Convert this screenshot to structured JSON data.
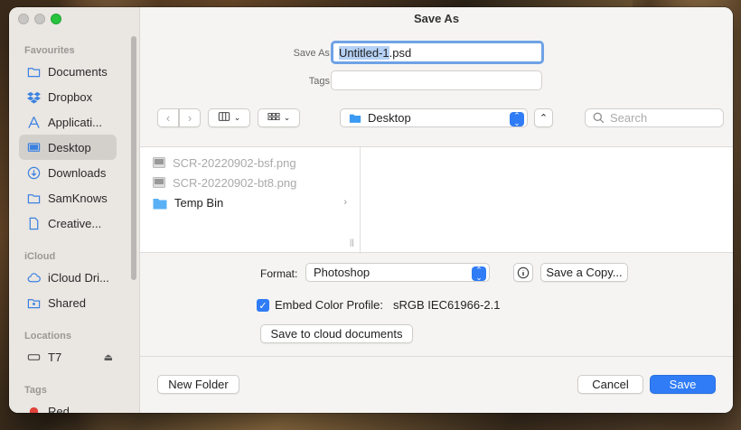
{
  "window": {
    "title": "Save As"
  },
  "sidebar": {
    "sections": [
      {
        "label": "Favourites"
      },
      {
        "label": "iCloud"
      },
      {
        "label": "Locations"
      },
      {
        "label": "Tags"
      }
    ],
    "favourites": [
      {
        "label": "Documents",
        "icon": "folder-icon"
      },
      {
        "label": "Dropbox",
        "icon": "dropbox-icon"
      },
      {
        "label": "Applicati...",
        "icon": "applications-icon"
      },
      {
        "label": "Desktop",
        "icon": "desktop-icon",
        "active": true
      },
      {
        "label": "Downloads",
        "icon": "downloads-icon"
      },
      {
        "label": "SamKnows",
        "icon": "folder-icon"
      },
      {
        "label": "Creative...",
        "icon": "document-icon"
      }
    ],
    "icloud": [
      {
        "label": "iCloud Dri...",
        "icon": "cloud-icon"
      },
      {
        "label": "Shared",
        "icon": "shared-folder-icon"
      }
    ],
    "locations": [
      {
        "label": "T7",
        "icon": "drive-icon"
      }
    ],
    "tags": [
      {
        "label": "Red",
        "color": "#e0433b"
      }
    ]
  },
  "form": {
    "save_as_label": "Save As:",
    "filename_selected": "Untitled-1",
    "filename_rest": ".psd",
    "tags_label": "Tags:",
    "tags_value": ""
  },
  "toolbar": {
    "location": "Desktop",
    "search_placeholder": "Search"
  },
  "files": [
    {
      "name": "SCR-20220902-bsf.png",
      "dim": true
    },
    {
      "name": "SCR-20220902-bt8.png",
      "dim": true
    },
    {
      "name": "Temp Bin",
      "dim": false,
      "folder": true
    }
  ],
  "options": {
    "format_label": "Format:",
    "format_value": "Photoshop",
    "save_copy_label": "Save a Copy...",
    "embed_label": "Embed Color Profile:",
    "embed_value": "sRGB IEC61966-2.1",
    "embed_checked": true,
    "cloud_button": "Save to cloud documents"
  },
  "footer": {
    "new_folder": "New Folder",
    "cancel": "Cancel",
    "save": "Save"
  },
  "colors": {
    "accent": "#2f7cf6",
    "focus_ring": "#6fa2e6"
  }
}
